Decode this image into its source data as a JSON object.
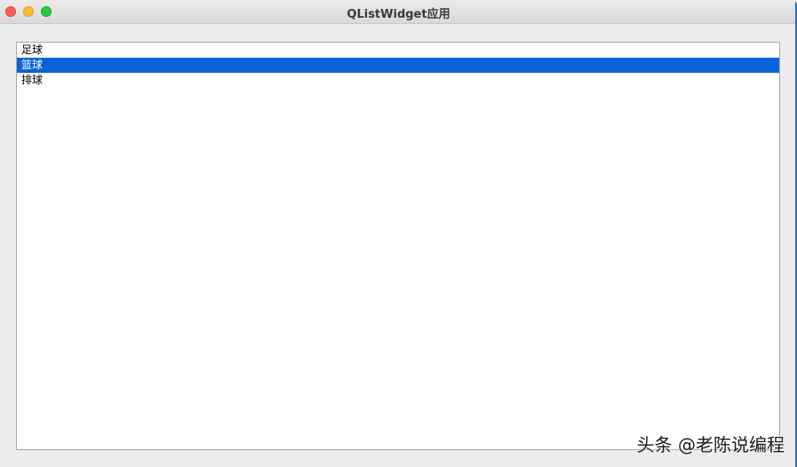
{
  "window": {
    "title": "QListWidget应用"
  },
  "list": {
    "items": [
      {
        "label": "足球",
        "selected": false
      },
      {
        "label": "篮球",
        "selected": true
      },
      {
        "label": "排球",
        "selected": false
      }
    ]
  },
  "watermark": {
    "text": "头条 @老陈说编程"
  },
  "colors": {
    "selection": "#0a63d6",
    "close": "#fe5f57",
    "minimize": "#febc2e",
    "maximize": "#28c840"
  }
}
